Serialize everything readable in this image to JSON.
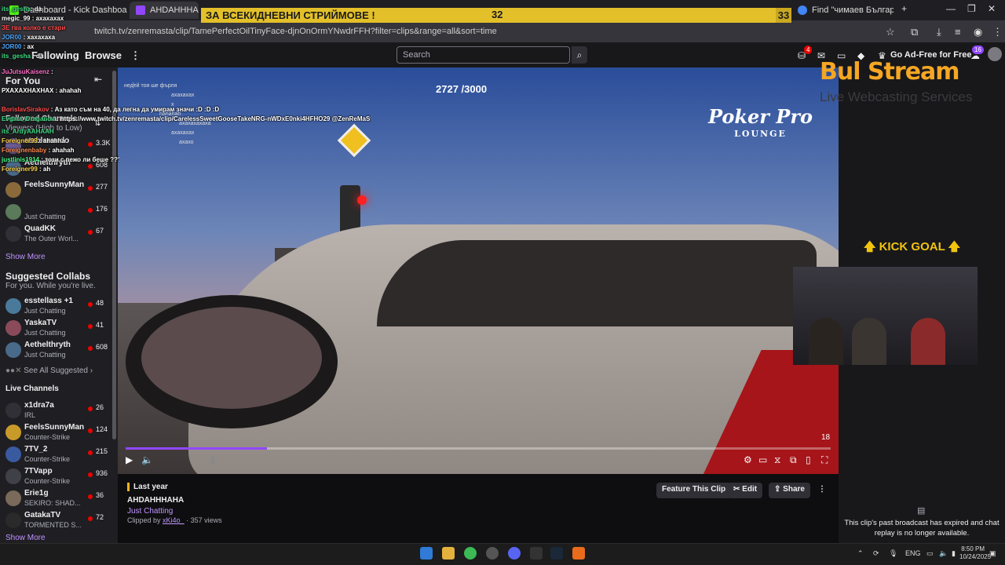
{
  "browser": {
    "tabs": [
      {
        "title": "Dashboard - Kick Dashboard",
        "active": false
      },
      {
        "title": "AHDAHHHAHA - Twi",
        "active": true
      },
      {
        "title": "",
        "active": false
      },
      {
        "title": "",
        "active": false
      },
      {
        "title": "",
        "active": false
      },
      {
        "title": "Find \"чимаев България\" on",
        "active": false
      }
    ],
    "url": "twitch.tv/zenremasta/clip/TamePerfectOilTinyFace-djnOnOrmYNwdrFFH?filter=clips&range=all&sort=time"
  },
  "banner": {
    "text": "ЗА ВСЕКИДНЕВНИ СТРИЙМОВЕ !",
    "count": "32",
    "count2": "33"
  },
  "nav": {
    "following": "Following",
    "browse": "Browse",
    "search_placeholder": "Search",
    "inbox_badge": "4",
    "prime_badge": "16",
    "ad_free": "Go Ad-Free for Free"
  },
  "sidebar": {
    "for_you": "For You",
    "followed_title": "Followed Channels",
    "followed_sub": "Viewers (High to Low)",
    "followed": [
      {
        "name": "stablerondo",
        "game": "",
        "viewers": "3.3K",
        "color": "#6b5b95"
      },
      {
        "name": "Aethelthryth",
        "game": "",
        "viewers": "608",
        "color": "#4a6a8a"
      },
      {
        "name": "FeelsSunnyMan",
        "game": "",
        "viewers": "277",
        "color": "#8a6a3a"
      },
      {
        "name": "",
        "game": "Just Chatting",
        "viewers": "176",
        "color": "#5a7a5a"
      },
      {
        "name": "QuadKK",
        "game": "The Outer Worl...",
        "viewers": "67",
        "color": "#303036"
      }
    ],
    "show_more_1": "Show More",
    "suggested_title": "Suggested Collabs",
    "suggested_sub": "For you. While you're live.",
    "suggested": [
      {
        "name": "esstellass +1",
        "game": "Just Chatting",
        "viewers": "48",
        "color": "#4a7a9a"
      },
      {
        "name": "YaskaTV",
        "game": "Just Chatting",
        "viewers": "41",
        "color": "#8a4a5a"
      },
      {
        "name": "Aethelthryth",
        "game": "Just Chatting",
        "viewers": "608",
        "color": "#4a6a8a"
      }
    ],
    "see_all": "See All Suggested",
    "live_title": "Live Channels",
    "live": [
      {
        "name": "x1dra7a",
        "game": "IRL",
        "viewers": "26",
        "color": "#303036"
      },
      {
        "name": "FeelsSunnyMan",
        "game": "Counter-Strike",
        "viewers": "124",
        "color": "#c89a2a"
      },
      {
        "name": "7TV_2",
        "game": "Counter-Strike",
        "viewers": "215",
        "color": "#3a5aa0"
      },
      {
        "name": "7TVapp",
        "game": "Counter-Strike",
        "viewers": "936",
        "color": "#404048"
      },
      {
        "name": "Erie1g",
        "game": "SEKIRO: SHAD...",
        "viewers": "36",
        "color": "#7a6a5a"
      },
      {
        "name": "GatakaTV",
        "game": "TORMENTED S...",
        "viewers": "72",
        "color": "#2a2a2a"
      }
    ],
    "show_more_2": "Show More"
  },
  "overlay_chat": [
    {
      "user": "its_gesha",
      "msg": "da",
      "color": "#3ddc84"
    },
    {
      "user": "megic_99",
      "msg": "ахахахах",
      "color": "#ffffff"
    },
    {
      "user": "",
      "msg": "ЗЕ гва колко е стари",
      "color": "#ff4d4d"
    },
    {
      "user": "JOR00",
      "msg": "хахахаха",
      "color": "#4da6ff"
    },
    {
      "user": "JOR00",
      "msg": "ах",
      "color": "#4da6ff"
    },
    {
      "user": "its_gesha",
      "msg": "da",
      "color": "#3ddc84"
    },
    {
      "user": "JuJutsuKaisenz",
      "msg": "",
      "color": "#ff6ec7"
    },
    {
      "user": "",
      "msg": "РХАХАХНАХНАХ : ahahah",
      "color": "#ffffff"
    },
    {
      "user": "BorislavSirakov",
      "msg": "Аз като съм на 40, да легна да умирам значи :D :D :D",
      "color": "#ff4d4d"
    },
    {
      "user": "Evgata_Draganov",
      "msg": "https://www.twitch.tv/zenremasta/clip/CarelessSweetGooseTakeNRG-nWDxE0nki4HFHO29 @ZenReMaSta",
      "color": "#3ddc84"
    },
    {
      "user": "its_ArdyAAHAAH",
      "msg": "",
      "color": "#3ddc84"
    },
    {
      "user": "Foreigner99",
      "msg": "ahahha",
      "color": "#ffd24d"
    },
    {
      "user": "Foreignenbaby",
      "msg": "ahahah",
      "color": "#ff8a4d"
    },
    {
      "user": "justlinis1914",
      "msg": "този с пежо ли беше ???",
      "color": "#4dff88"
    },
    {
      "user": "Foreigner99",
      "msg": "ah",
      "color": "#ffd24d"
    }
  ],
  "video": {
    "goal_tracker": "2727 /3000",
    "logo_title": "Poker Pro",
    "logo_sub": "LOUNGE",
    "time": "18",
    "progress": 0.2,
    "video_chat": [
      "нед̌ей тоя ше фърля",
      "ахахахах",
      "x",
      "hahahah",
      "ахахахахаха",
      "ахахахах",
      "ахахо"
    ]
  },
  "clip": {
    "last_year": "Last year",
    "title": "AHDAHHHAHA",
    "category": "Just Chatting",
    "clipped_by_label": "Clipped by",
    "clipper": "xKi4o_",
    "views": "· 357 views",
    "feature_btn": "Feature This Clip",
    "edit_btn": "Edit",
    "share_btn": "Share"
  },
  "right": {
    "brand": "Bul Stream",
    "brand_sub": "Live Webcasting Services",
    "kick_goal": "KICK GOAL",
    "replay_msg": "This clip's past broadcast has expired and chat replay is no longer available."
  },
  "taskbar": {
    "lang": "ENG",
    "time": "8:50 PM",
    "date": "10/24/2025"
  }
}
